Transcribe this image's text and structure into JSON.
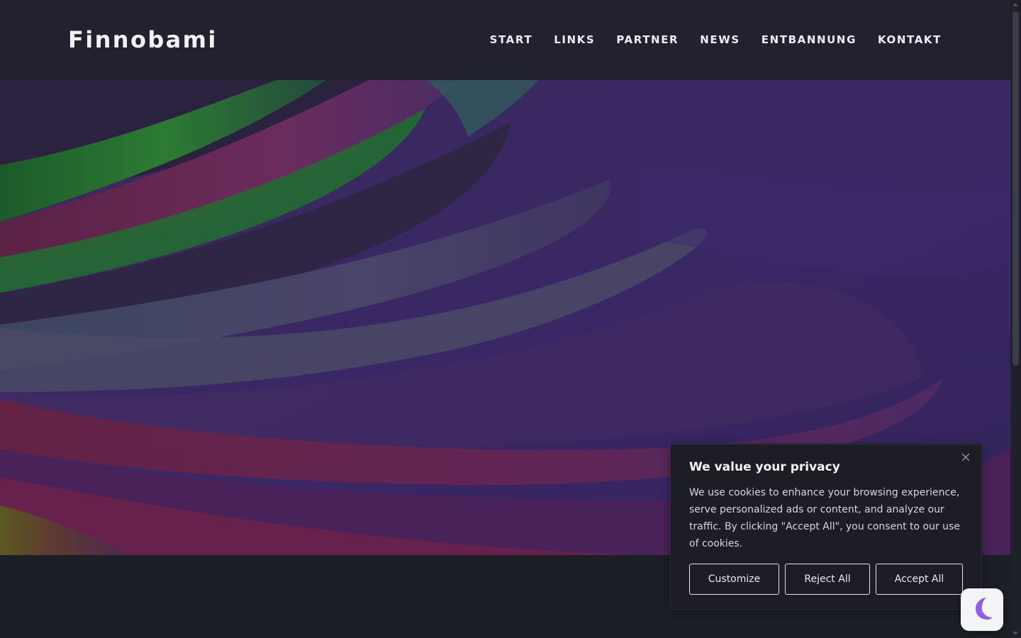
{
  "header": {
    "logo": "Finnobami",
    "nav": [
      "START",
      "LINKS",
      "PARTNER",
      "NEWS",
      "ENTBANNUNG",
      "KONTAKT"
    ]
  },
  "hero": {
    "image": "abstract-curved-paper-layers",
    "colors": [
      "#3a2560",
      "#1e6b2e",
      "#6a2a5e",
      "#4a3f6a"
    ]
  },
  "cookie_banner": {
    "title": "We value your privacy",
    "text": "We use cookies to enhance your browsing experience, serve personalized ads or content, and analyze our traffic. By clicking \"Accept All\", you consent to our use of cookies.",
    "buttons": {
      "customize": "Customize",
      "reject": "Reject All",
      "accept": "Accept All"
    },
    "close_icon": "close-icon"
  },
  "dark_mode_toggle": {
    "icon": "moon-icon",
    "accent": "#8e5af0"
  }
}
